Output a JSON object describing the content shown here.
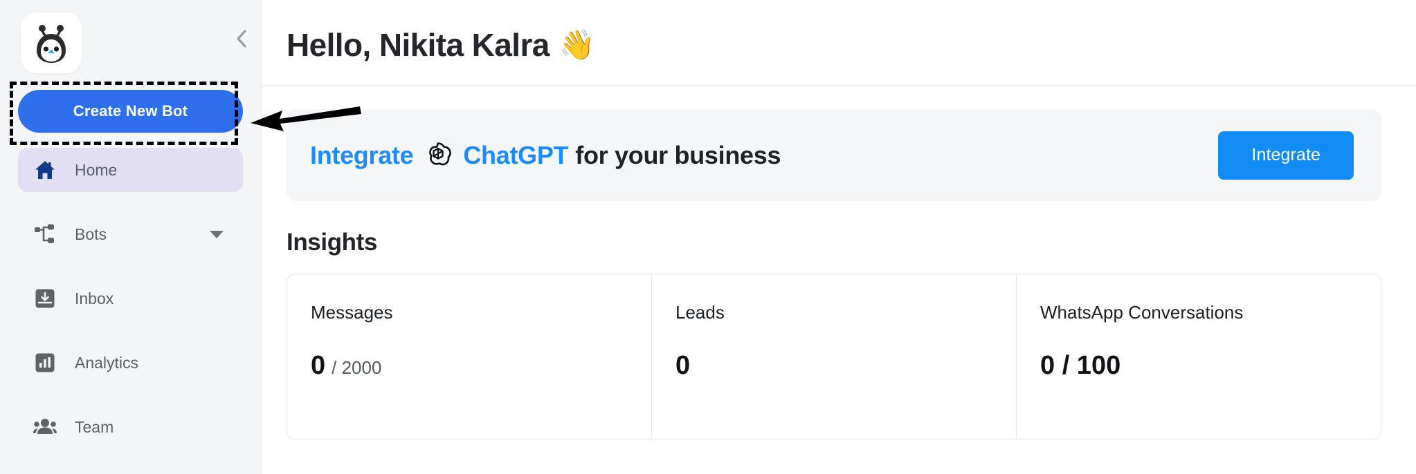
{
  "sidebar": {
    "logo_icon": "bot-mascot-logo",
    "collapse_icon": "chevron-left-icon",
    "create_button_label": "Create New Bot",
    "items": [
      {
        "label": "Home",
        "icon": "home-icon",
        "active": true,
        "caret": false
      },
      {
        "label": "Bots",
        "icon": "bots-icon",
        "active": false,
        "caret": true
      },
      {
        "label": "Inbox",
        "icon": "inbox-icon",
        "active": false,
        "caret": false
      },
      {
        "label": "Analytics",
        "icon": "analytics-icon",
        "active": false,
        "caret": false
      },
      {
        "label": "Team",
        "icon": "team-icon",
        "active": false,
        "caret": false
      }
    ]
  },
  "header": {
    "greeting": "Hello, Nikita Kalra",
    "wave_emoji": "👋"
  },
  "banner": {
    "text_lead": "Integrate",
    "logo_icon": "openai-logo-icon",
    "text_brand": "ChatGPT",
    "text_tail": "for your business",
    "button_label": "Integrate",
    "accent_color": "#1a8cff",
    "button_color": "#118cf5"
  },
  "insights": {
    "title": "Insights",
    "cards": [
      {
        "label": "Messages",
        "value": "0",
        "sub": "/ 2000"
      },
      {
        "label": "Leads",
        "value": "0",
        "sub": ""
      },
      {
        "label": "WhatsApp Conversations",
        "value": "0 / 100",
        "sub": ""
      }
    ]
  },
  "annotation": {
    "arrow_icon": "pointer-arrow-icon",
    "highlight_icon": "dashed-highlight-box"
  }
}
